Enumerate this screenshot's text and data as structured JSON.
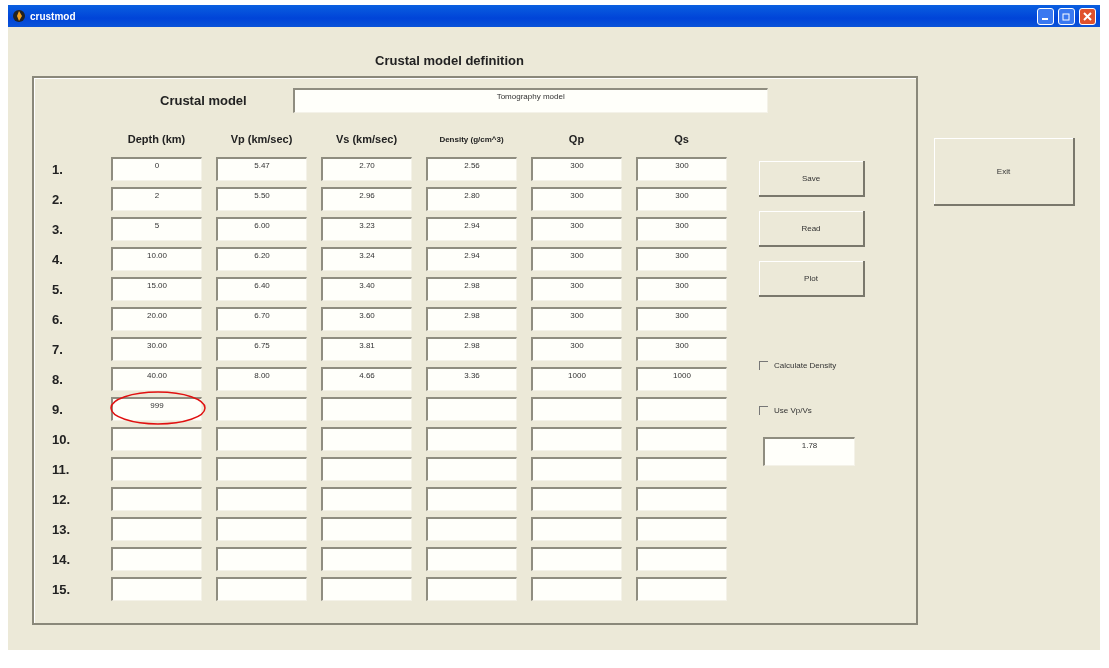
{
  "window": {
    "title": "crustmod"
  },
  "heading": "Crustal model definition",
  "model": {
    "label": "Crustal model",
    "value": "Tomography model"
  },
  "columns": [
    "Depth (km)",
    "Vp (km/sec)",
    "Vs (km/sec)",
    "Density (g/cm^3)",
    "Qp",
    "Qs"
  ],
  "rows": [
    {
      "label": "1.",
      "values": [
        "0",
        "5.47",
        "2.70",
        "2.56",
        "300",
        "300"
      ],
      "circled": false
    },
    {
      "label": "2.",
      "values": [
        "2",
        "5.50",
        "2.96",
        "2.80",
        "300",
        "300"
      ],
      "circled": false
    },
    {
      "label": "3.",
      "values": [
        "5",
        "6.00",
        "3.23",
        "2.94",
        "300",
        "300"
      ],
      "circled": false
    },
    {
      "label": "4.",
      "values": [
        "10.00",
        "6.20",
        "3.24",
        "2.94",
        "300",
        "300"
      ],
      "circled": false
    },
    {
      "label": "5.",
      "values": [
        "15.00",
        "6.40",
        "3.40",
        "2.98",
        "300",
        "300"
      ],
      "circled": false
    },
    {
      "label": "6.",
      "values": [
        "20.00",
        "6.70",
        "3.60",
        "2.98",
        "300",
        "300"
      ],
      "circled": false
    },
    {
      "label": "7.",
      "values": [
        "30.00",
        "6.75",
        "3.81",
        "2.98",
        "300",
        "300"
      ],
      "circled": false
    },
    {
      "label": "8.",
      "values": [
        "40.00",
        "8.00",
        "4.66",
        "3.36",
        "1000",
        "1000"
      ],
      "circled": false
    },
    {
      "label": "9.",
      "values": [
        "999"
      ],
      "circled": true
    },
    {
      "label": "10.",
      "values": [],
      "circled": false
    },
    {
      "label": "11.",
      "values": [],
      "circled": false
    },
    {
      "label": "12.",
      "values": [],
      "circled": false
    },
    {
      "label": "13.",
      "values": [],
      "circled": false
    },
    {
      "label": "14.",
      "values": [],
      "circled": false
    },
    {
      "label": "15.",
      "values": [],
      "circled": false
    }
  ],
  "buttons": [
    "Save",
    "Read",
    "Plot"
  ],
  "options": [
    {
      "label": "Calculate Density",
      "checked": false
    },
    {
      "label": "Use Vp/Vs",
      "checked": false
    }
  ],
  "ratio": "1.78",
  "exit": "Exit"
}
